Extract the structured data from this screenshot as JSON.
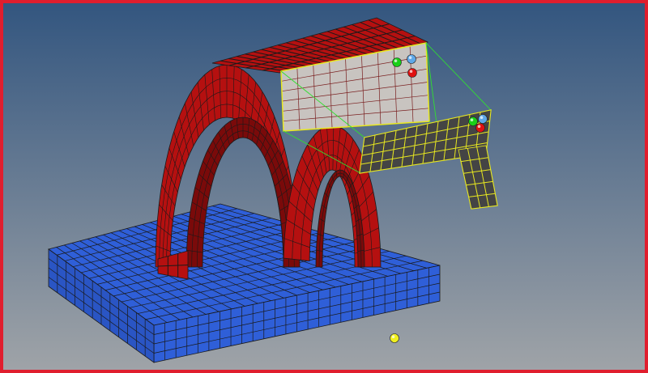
{
  "viewport": {
    "background_top": "#32557f",
    "background_bottom": "#a0a4a8",
    "frame_color": "#e01e2e"
  },
  "model": {
    "base_block_color": "#2f5fd8",
    "arch_color": "#b51010",
    "arch_inner_color": "#7a0a0a",
    "selected_face_color": "#c8c4c0",
    "sweep_surface_color": "#444444",
    "mesh_line_color": "#1a1a1a",
    "selection_edge_color": "#e8e820",
    "guide_line_color": "#30e030"
  },
  "handles": {
    "colors": {
      "x": "#e01010",
      "y": "#18d018",
      "z": "#5fa8e8",
      "origin": "#f0f020"
    }
  }
}
